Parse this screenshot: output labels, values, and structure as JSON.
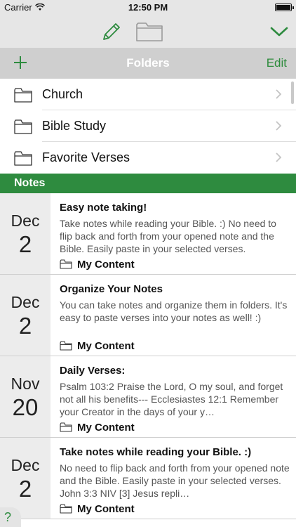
{
  "status": {
    "carrier": "Carrier",
    "time": "12:50 PM"
  },
  "toolbar": {
    "compose_icon": "pencil-icon",
    "folder_icon": "folder-icon",
    "collapse_icon": "chevron-down-icon"
  },
  "folders": {
    "title": "Folders",
    "edit_label": "Edit",
    "items": [
      {
        "label": "Church"
      },
      {
        "label": "Bible Study"
      },
      {
        "label": "Favorite Verses"
      }
    ]
  },
  "notes": {
    "title": "Notes",
    "items": [
      {
        "month": "Dec",
        "day": "2",
        "title": "Easy note taking!",
        "text": "Take notes while reading your Bible. :)   No need to flip back and forth from your opened note and the Bible. Easily paste in your selected verses.",
        "folder": "My Content"
      },
      {
        "month": "Dec",
        "day": "2",
        "title": "Organize Your Notes",
        "text": "You can take notes and organize them in folders. It's easy to paste verses into your notes as well! :)",
        "folder": "My Content"
      },
      {
        "month": "Nov",
        "day": "20",
        "title": "Daily Verses:",
        "text": "Psalm 103:2 Praise the Lord, O my soul, and forget not all his benefits---  Ecclesiastes 12:1 Remember your Creator in the days of your y…",
        "folder": "My Content"
      },
      {
        "month": "Dec",
        "day": "2",
        "title": "Take notes while reading your Bible. :)",
        "text": "No need to flip back and forth from your opened note and the Bible.   Easily paste in your selected verses.  John 3:3 NIV [3] Jesus repli…",
        "folder": "My Content"
      }
    ]
  },
  "help": {
    "label": "?"
  },
  "colors": {
    "accent": "#2e8b3f",
    "header_gray": "#cfcfcf",
    "toolbar_gray": "#e6e6e6"
  }
}
